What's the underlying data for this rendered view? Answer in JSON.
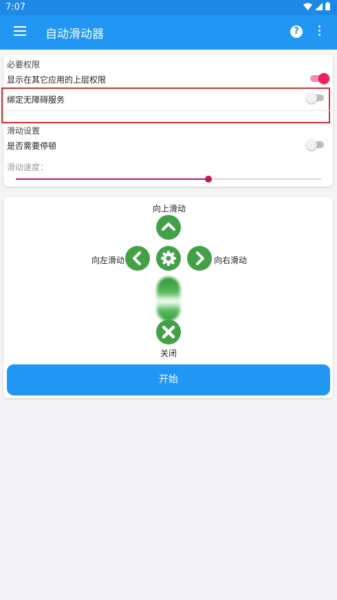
{
  "status_bar": {
    "time": "7:07"
  },
  "app_bar": {
    "title": "自动滑动器",
    "help_glyph": "?"
  },
  "permissions": {
    "section_title": "必要权限",
    "overlay_label": "显示在其它应用的上层权限",
    "overlay_enabled": true,
    "accessibility_label": "绑定无障碍服务",
    "accessibility_enabled": false
  },
  "swipe_settings": {
    "section_title": "滑动设置",
    "pause_label": "是否需要停顿",
    "pause_enabled": false,
    "speed_label": "滑动速度：",
    "speed_value_fraction": 0.63
  },
  "controls": {
    "up_label": "向上滑动",
    "left_label": "向左滑动",
    "right_label": "向右滑动",
    "close_label": "关闭",
    "start_label": "开始"
  },
  "colors": {
    "primary": "#2196f3",
    "accent": "#e91e63",
    "control_green": "#43a047",
    "highlight": "#d32f2f"
  }
}
